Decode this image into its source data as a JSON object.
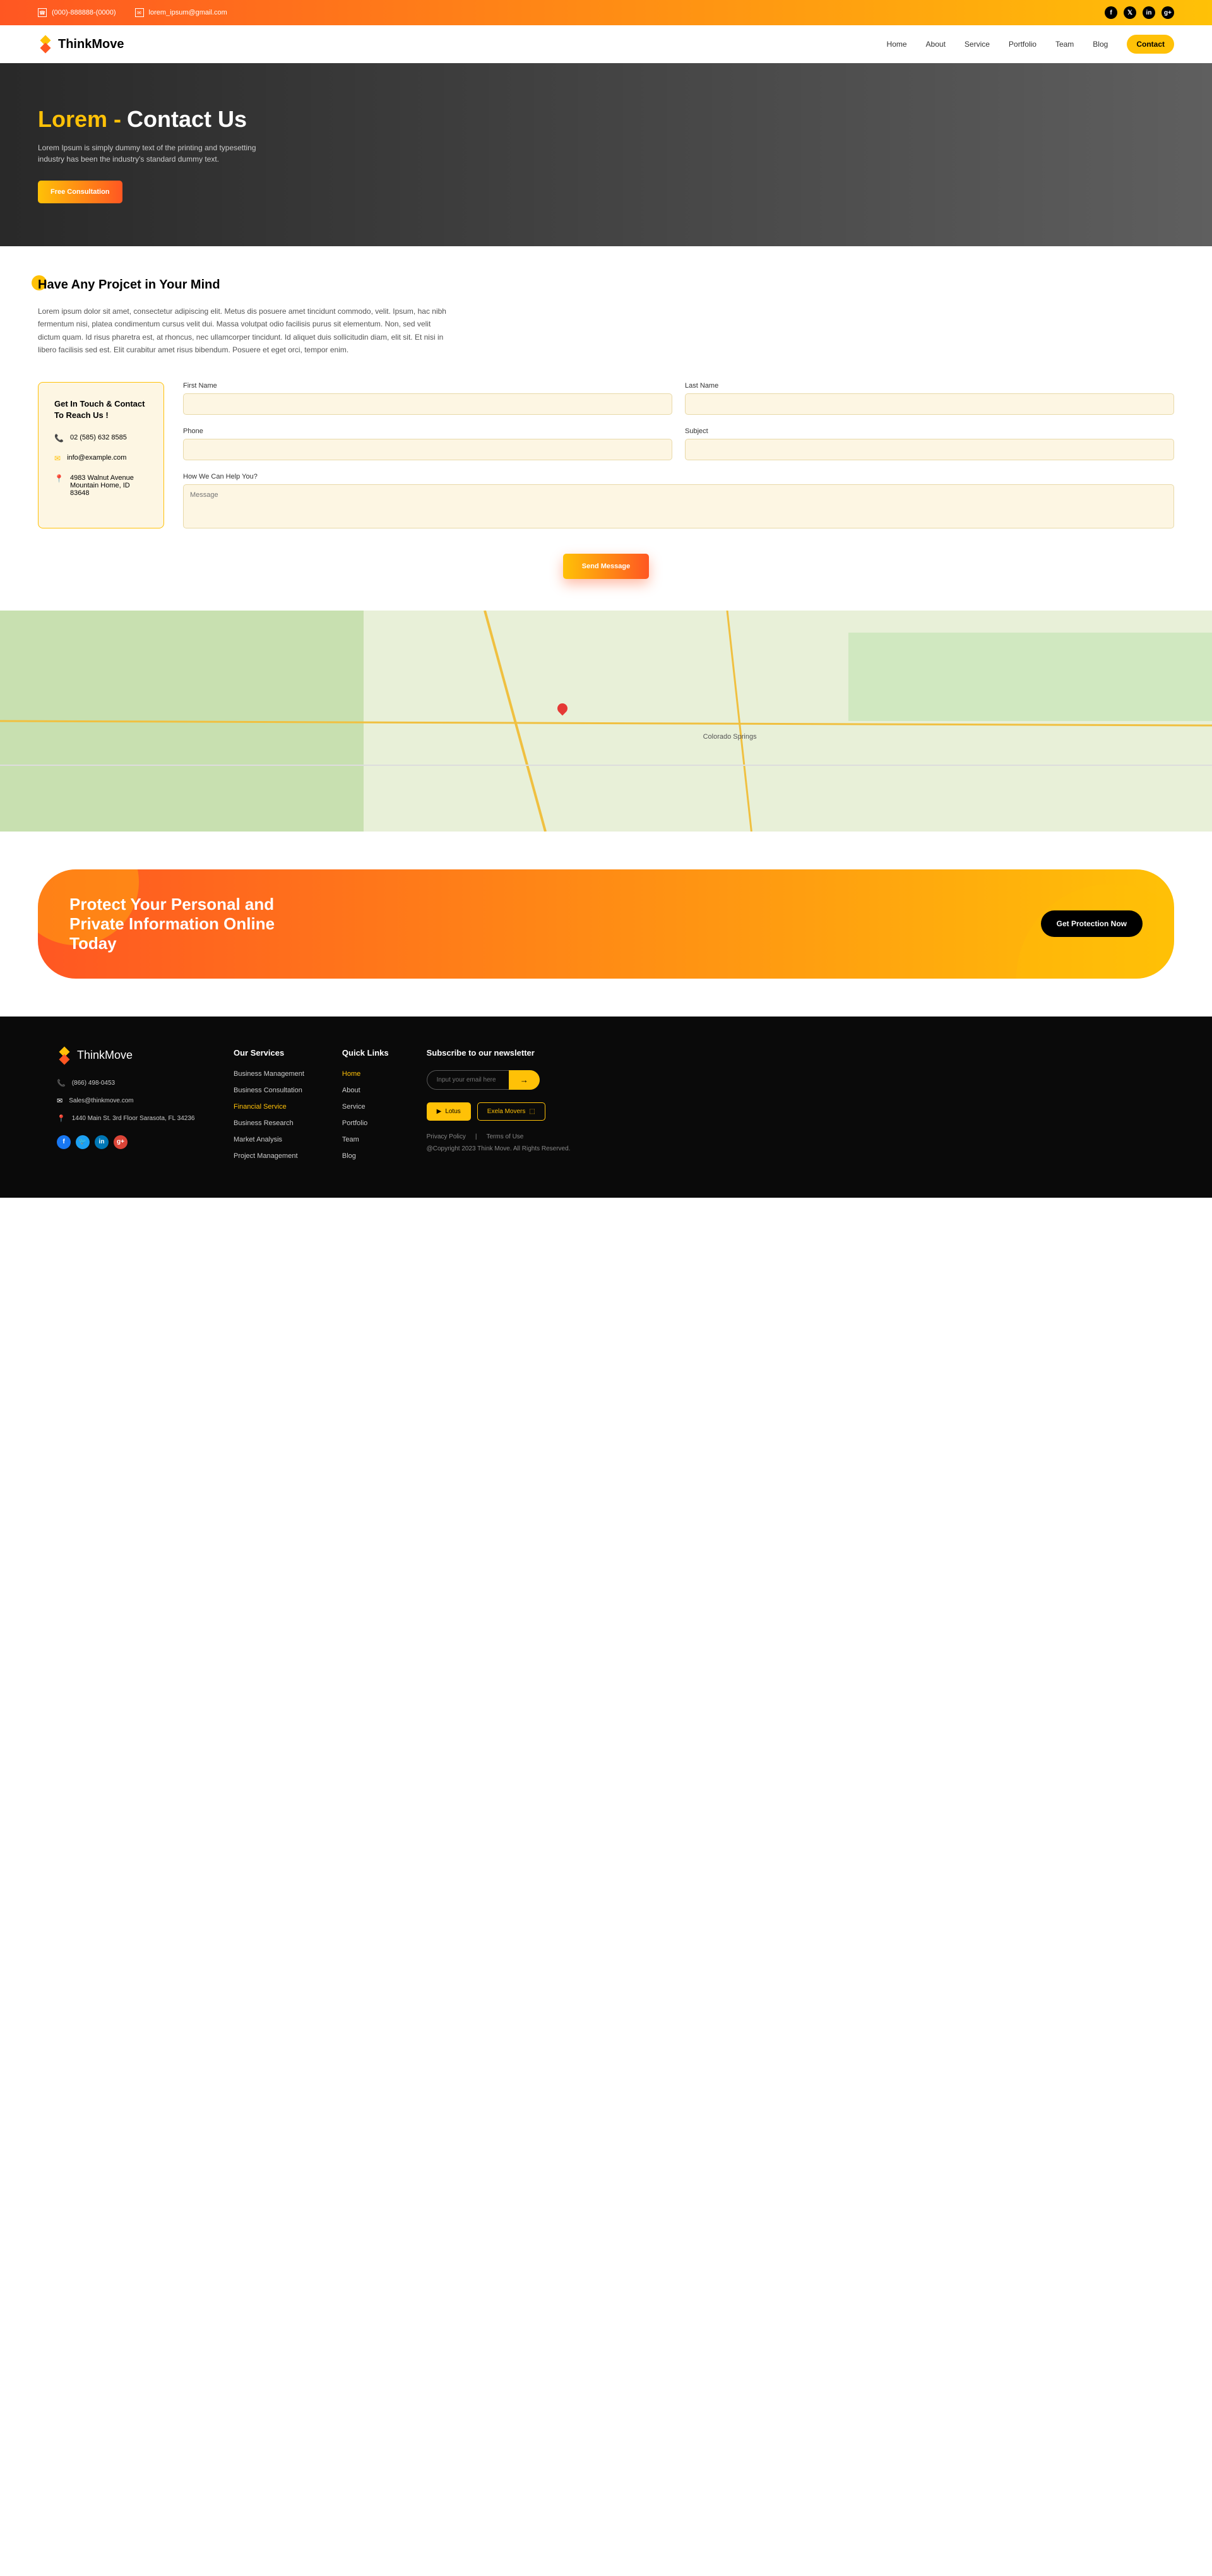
{
  "topbar": {
    "phone": "(000)-888888-(0000)",
    "email": "lorem_ipsum@gmail.com"
  },
  "brand": "ThinkMove",
  "nav": {
    "items": [
      "Home",
      "About",
      "Service",
      "Portfolio",
      "Team",
      "Blog"
    ],
    "active": "Contact"
  },
  "hero": {
    "title_orange": "Lorem -",
    "title_white": "Contact Us",
    "desc": "Lorem Ipsum is simply dummy text of the printing and typesetting industry has been the industry's standard dummy text.",
    "cta": "Free Consultation"
  },
  "project": {
    "heading": "Have Any Projcet in Your Mind",
    "desc": "Lorem ipsum dolor sit amet, consectetur adipiscing elit. Metus dis posuere amet tincidunt commodo, velit. Ipsum, hac nibh fermentum nisi, platea condimentum cursus velit dui. Massa volutpat odio facilisis purus sit elementum. Non, sed velit dictum quam. Id risus pharetra est, at rhoncus, nec ullamcorper tincidunt. Id aliquet duis sollicitudin diam, elit sit. Et nisi in libero facilisis sed est. Elit curabitur amet risus bibendum. Posuere et eget orci, tempor enim."
  },
  "contact_card": {
    "heading": "Get In Touch & Contact To Reach Us !",
    "phone": "02 (585) 632 8585",
    "email": "info@example.com",
    "address": "4983 Walnut Avenue Mountain Home, ID 83648"
  },
  "form": {
    "first_name": "First Name",
    "last_name": "Last Name",
    "phone": "Phone",
    "subject": "Subject",
    "message_label": "How We Can Help You?",
    "message_placeholder": "Message",
    "send": "Send Message"
  },
  "cta": {
    "text": "Protect Your Personal and Private Information Online Today",
    "button": "Get Protection Now"
  },
  "footer": {
    "brand": "ThinkMove",
    "phone": "(866) 498-0453",
    "email": "Sales@thinkmove.com",
    "address": "1440 Main St. 3rd Floor Sarasota, FL 34236",
    "services_heading": "Our Services",
    "services": [
      "Business Management",
      "Business Consultation",
      "Financial Service",
      "Business Research",
      "Market Analysis",
      "Project Management"
    ],
    "quick_heading": "Quick Links",
    "quick": [
      "Home",
      "About",
      "Service",
      "Portfolio",
      "Team",
      "Blog"
    ],
    "newsletter_heading": "Subscribe to our newsletter",
    "newsletter_placeholder": "Input your email here",
    "newsletter_btn": "→",
    "app1": "Lotus",
    "app2": "Exela Movers",
    "privacy": "Privacy Policy",
    "terms": "Terms of Use",
    "copyright": "@Copyright 2023 Think Move. All Rights Reserved."
  }
}
